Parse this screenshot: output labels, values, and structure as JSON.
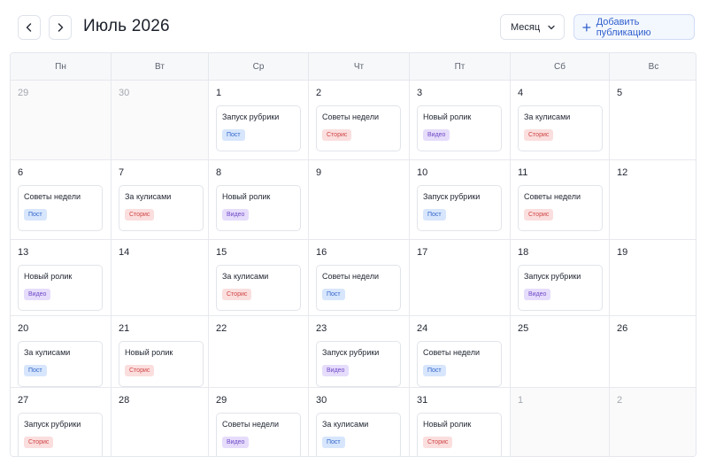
{
  "header": {
    "title": "Июль 2026",
    "view_label": "Месяц",
    "add_label": "Добавить публикацию"
  },
  "weekdays": [
    "Пн",
    "Вт",
    "Ср",
    "Чт",
    "Пт",
    "Сб",
    "Вс"
  ],
  "tag_styles": {
    "Пост": {
      "bg": "#d7e6fc",
      "fg": "#2f62c9"
    },
    "Сторис": {
      "bg": "#fbdede",
      "fg": "#cf4545"
    },
    "Видео": {
      "bg": "#e6dcfb",
      "fg": "#6e4ac7"
    }
  },
  "weeks": [
    [
      {
        "day": "29",
        "muted": true
      },
      {
        "day": "30",
        "muted": true
      },
      {
        "day": "1",
        "event": {
          "title": "Запуск рубрики",
          "tag": "Пост"
        }
      },
      {
        "day": "2",
        "event": {
          "title": "Советы недели",
          "tag": "Сторис"
        }
      },
      {
        "day": "3",
        "event": {
          "title": "Новый ролик",
          "tag": "Видео"
        }
      },
      {
        "day": "4",
        "event": {
          "title": "За кулисами",
          "tag": "Сторис"
        }
      },
      {
        "day": "5"
      }
    ],
    [
      {
        "day": "6",
        "event": {
          "title": "Советы недели",
          "tag": "Пост"
        }
      },
      {
        "day": "7",
        "event": {
          "title": "За кулисами",
          "tag": "Сторис"
        }
      },
      {
        "day": "8",
        "event": {
          "title": "Новый ролик",
          "tag": "Видео"
        }
      },
      {
        "day": "9"
      },
      {
        "day": "10",
        "event": {
          "title": "Запуск рубрики",
          "tag": "Пост"
        }
      },
      {
        "day": "11",
        "event": {
          "title": "Советы недели",
          "tag": "Сторис"
        }
      },
      {
        "day": "12"
      }
    ],
    [
      {
        "day": "13",
        "event": {
          "title": "Новый ролик",
          "tag": "Видео"
        }
      },
      {
        "day": "14"
      },
      {
        "day": "15",
        "event": {
          "title": "За кулисами",
          "tag": "Сторис"
        }
      },
      {
        "day": "16",
        "event": {
          "title": "Советы недели",
          "tag": "Пост"
        }
      },
      {
        "day": "17"
      },
      {
        "day": "18",
        "event": {
          "title": "Запуск рубрики",
          "tag": "Видео"
        }
      },
      {
        "day": "19"
      }
    ],
    [
      {
        "day": "20",
        "event": {
          "title": "За кулисами",
          "tag": "Пост"
        }
      },
      {
        "day": "21",
        "event": {
          "title": "Новый ролик",
          "tag": "Сторис"
        }
      },
      {
        "day": "22"
      },
      {
        "day": "23",
        "event": {
          "title": "Запуск рубрики",
          "tag": "Видео"
        }
      },
      {
        "day": "24",
        "event": {
          "title": "Советы недели",
          "tag": "Пост"
        }
      },
      {
        "day": "25"
      },
      {
        "day": "26"
      }
    ],
    [
      {
        "day": "27",
        "event": {
          "title": "Запуск рубрики",
          "tag": "Сторис"
        }
      },
      {
        "day": "28"
      },
      {
        "day": "29",
        "event": {
          "title": "Советы недели",
          "tag": "Видео"
        }
      },
      {
        "day": "30",
        "event": {
          "title": "За кулисами",
          "tag": "Пост"
        }
      },
      {
        "day": "31",
        "event": {
          "title": "Новый ролик",
          "tag": "Сторис"
        }
      },
      {
        "day": "1",
        "muted": true
      },
      {
        "day": "2",
        "muted": true
      }
    ]
  ]
}
